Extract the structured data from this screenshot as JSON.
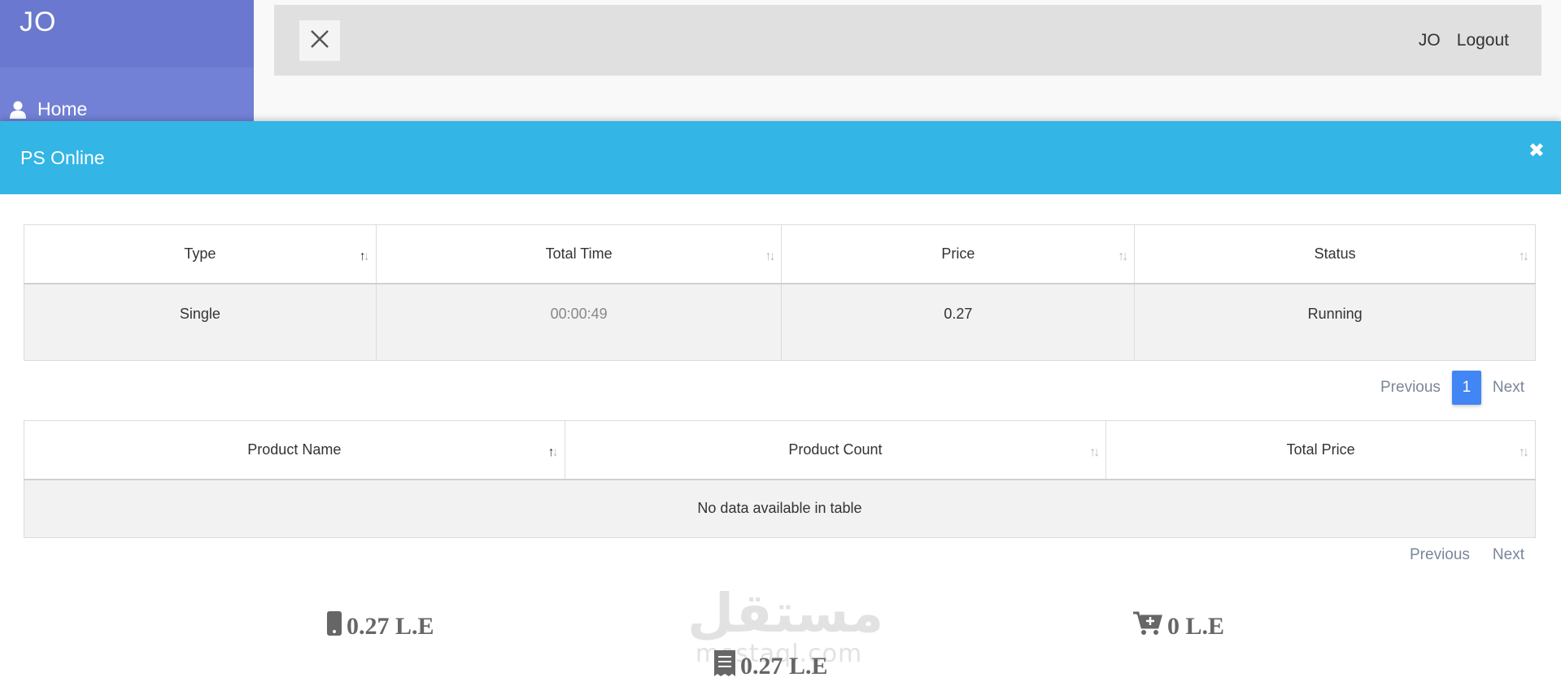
{
  "sidebar": {
    "brand": "JO",
    "items": [
      {
        "label": "Home",
        "icon": "user-icon"
      }
    ]
  },
  "topbar": {
    "user": "JO",
    "logout": "Logout"
  },
  "modal": {
    "title": "PS Online",
    "sessions_table": {
      "columns": [
        "Type",
        "Total Time",
        "Price",
        "Status"
      ],
      "rows": [
        [
          "Single",
          "00:00:49",
          "0.27",
          "Running"
        ]
      ]
    },
    "sessions_pager": {
      "previous": "Previous",
      "page": "1",
      "next": "Next"
    },
    "products_table": {
      "columns": [
        "Product Name",
        "Product Count",
        "Total Price"
      ],
      "empty_message": "No data available in table"
    },
    "products_pager": {
      "previous": "Previous",
      "next": "Next"
    },
    "summary": {
      "ps_total": "0.27 L.E",
      "cart_total": "0 L.E",
      "grand_total": "0.27 L.E"
    },
    "watermark": {
      "arabic": "مستقل",
      "latin": "mostaql.com"
    }
  },
  "colors": {
    "sidebar": "#7281d6",
    "header": "#33b5e5",
    "accent": "#4285f4"
  }
}
